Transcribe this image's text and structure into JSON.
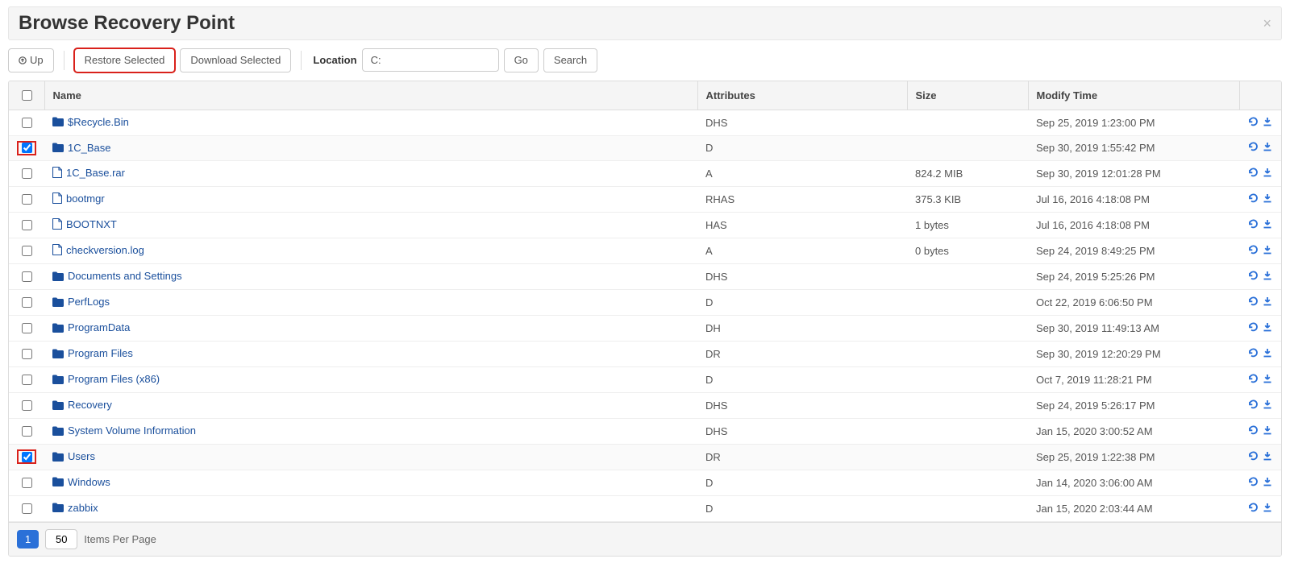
{
  "header": {
    "title": "Browse Recovery Point"
  },
  "toolbar": {
    "up_label": "Up",
    "restore_label": "Restore Selected",
    "download_label": "Download Selected",
    "location_label": "Location",
    "location_value": "C:",
    "go_label": "Go",
    "search_label": "Search"
  },
  "columns": {
    "name": "Name",
    "attributes": "Attributes",
    "size": "Size",
    "modify": "Modify Time"
  },
  "icons": {
    "folder": "folder-icon",
    "file": "file-icon",
    "restore_row": "restore-icon",
    "download_row": "download-icon",
    "up_arrow": "arrow-up-icon",
    "close": "close-icon"
  },
  "colors": {
    "link": "#1a4f9c",
    "accent": "#2a70d8",
    "highlight": "#d9211b"
  },
  "rows": [
    {
      "name": "$Recycle.Bin",
      "type": "folder",
      "attributes": "DHS",
      "size": "",
      "modify": "Sep 25, 2019 1:23:00 PM",
      "checked": false,
      "hl_cb": false
    },
    {
      "name": "1C_Base",
      "type": "folder",
      "attributes": "D",
      "size": "",
      "modify": "Sep 30, 2019 1:55:42 PM",
      "checked": true,
      "hl_cb": true
    },
    {
      "name": "1C_Base.rar",
      "type": "file",
      "attributes": "A",
      "size": "824.2 MIB",
      "modify": "Sep 30, 2019 12:01:28 PM",
      "checked": false,
      "hl_cb": false
    },
    {
      "name": "bootmgr",
      "type": "file",
      "attributes": "RHAS",
      "size": "375.3 KIB",
      "modify": "Jul 16, 2016 4:18:08 PM",
      "checked": false,
      "hl_cb": false
    },
    {
      "name": "BOOTNXT",
      "type": "file",
      "attributes": "HAS",
      "size": "1 bytes",
      "modify": "Jul 16, 2016 4:18:08 PM",
      "checked": false,
      "hl_cb": false
    },
    {
      "name": "checkversion.log",
      "type": "file",
      "attributes": "A",
      "size": "0 bytes",
      "modify": "Sep 24, 2019 8:49:25 PM",
      "checked": false,
      "hl_cb": false
    },
    {
      "name": "Documents and Settings",
      "type": "folder",
      "attributes": "DHS",
      "size": "",
      "modify": "Sep 24, 2019 5:25:26 PM",
      "checked": false,
      "hl_cb": false
    },
    {
      "name": "PerfLogs",
      "type": "folder",
      "attributes": "D",
      "size": "",
      "modify": "Oct 22, 2019 6:06:50 PM",
      "checked": false,
      "hl_cb": false
    },
    {
      "name": "ProgramData",
      "type": "folder",
      "attributes": "DH",
      "size": "",
      "modify": "Sep 30, 2019 11:49:13 AM",
      "checked": false,
      "hl_cb": false
    },
    {
      "name": "Program Files",
      "type": "folder",
      "attributes": "DR",
      "size": "",
      "modify": "Sep 30, 2019 12:20:29 PM",
      "checked": false,
      "hl_cb": false
    },
    {
      "name": "Program Files (x86)",
      "type": "folder",
      "attributes": "D",
      "size": "",
      "modify": "Oct 7, 2019 11:28:21 PM",
      "checked": false,
      "hl_cb": false
    },
    {
      "name": "Recovery",
      "type": "folder",
      "attributes": "DHS",
      "size": "",
      "modify": "Sep 24, 2019 5:26:17 PM",
      "checked": false,
      "hl_cb": false
    },
    {
      "name": "System Volume Information",
      "type": "folder",
      "attributes": "DHS",
      "size": "",
      "modify": "Jan 15, 2020 3:00:52 AM",
      "checked": false,
      "hl_cb": false
    },
    {
      "name": "Users",
      "type": "folder",
      "attributes": "DR",
      "size": "",
      "modify": "Sep 25, 2019 1:22:38 PM",
      "checked": true,
      "hl_cb": true
    },
    {
      "name": "Windows",
      "type": "folder",
      "attributes": "D",
      "size": "",
      "modify": "Jan 14, 2020 3:06:00 AM",
      "checked": false,
      "hl_cb": false
    },
    {
      "name": "zabbix",
      "type": "folder",
      "attributes": "D",
      "size": "",
      "modify": "Jan 15, 2020 2:03:44 AM",
      "checked": false,
      "hl_cb": false
    }
  ],
  "footer": {
    "page": "1",
    "items_per_page_value": "50",
    "items_per_page_label": "Items Per Page"
  }
}
